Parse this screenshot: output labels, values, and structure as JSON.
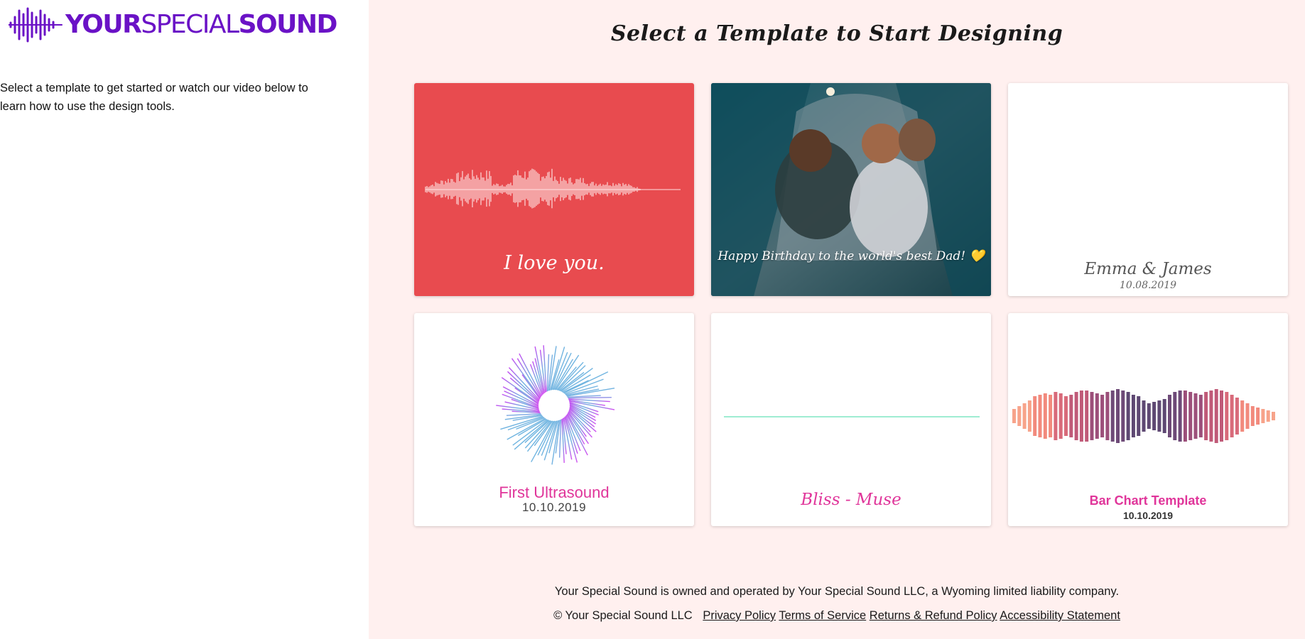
{
  "brand": {
    "part1": "YOUR",
    "part2": "SPECIAL",
    "part3": "SOUND",
    "color": "#6a12c6"
  },
  "sidebar": {
    "intro": "Select a template to get started or watch our video below to learn how to use the design tools."
  },
  "main": {
    "title": "Select a Template to Start Designing",
    "background": "#fff0ef"
  },
  "templates": [
    {
      "caption": "I love you.",
      "background": "#e84b4f"
    },
    {
      "caption": "Happy Birthday to the world's best Dad! 💛"
    },
    {
      "caption": "Emma & James",
      "date": "10.08.2019"
    },
    {
      "caption": "First Ultrasound",
      "date": "10.10.2019"
    },
    {
      "caption": "Bliss - Muse"
    },
    {
      "caption": "Bar Chart Template",
      "date": "10.10.2019"
    }
  ],
  "footer": {
    "note": "Your Special Sound is owned and operated by Your Special Sound LLC, a Wyoming limited liability company.",
    "copyright": "© Your Special Sound LLC",
    "links": [
      "Privacy Policy",
      "Terms of Service",
      "Returns & Refund Policy",
      "Accessibility Statement"
    ]
  }
}
